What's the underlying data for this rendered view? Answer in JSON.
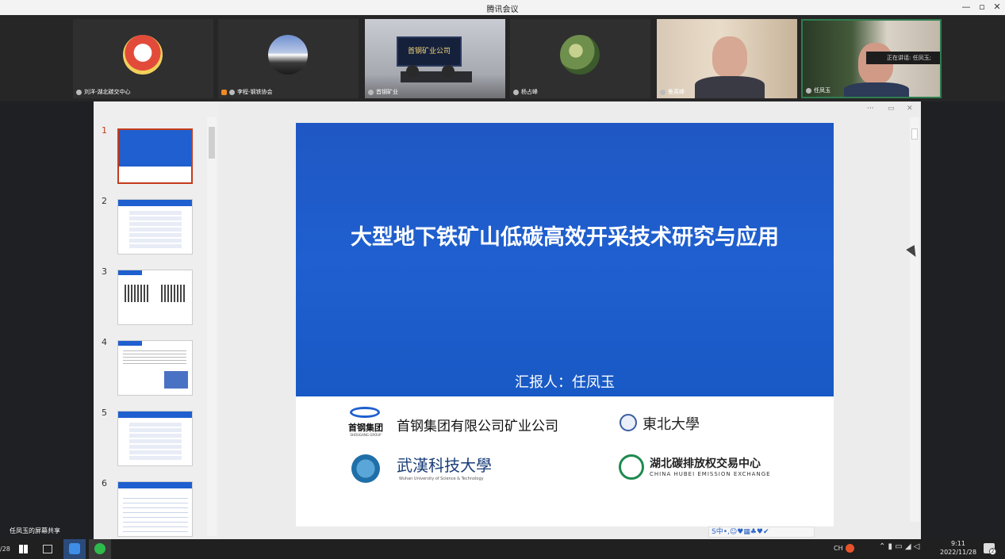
{
  "window": {
    "title": "腾讯会议",
    "minimize": "—",
    "restore": "▫",
    "close": "✕"
  },
  "participants": [
    {
      "name": "刘洋-湖北碳交中心"
    },
    {
      "name": "李程-钢铁协会"
    },
    {
      "name": "首钢矿业",
      "banner": "首钢矿业公司"
    },
    {
      "name": "杨占峰"
    },
    {
      "name": "鲁英峰"
    },
    {
      "name": "任凤玉"
    }
  ],
  "speaking": {
    "text": "正在讲话: 任凤玉;"
  },
  "ppt": {
    "thumbnails": [
      {
        "number": "1"
      },
      {
        "number": "2"
      },
      {
        "number": "3"
      },
      {
        "number": "4"
      },
      {
        "number": "5"
      },
      {
        "number": "6"
      }
    ],
    "window_controls": {
      "more": "···",
      "pin": "▭",
      "close": "✕"
    }
  },
  "slide": {
    "title": "大型地下铁矿山低碳高效开采技术研究与应用",
    "reporter": "汇报人：任凤玉",
    "logos": [
      {
        "text": "首钢集团有限公司矿业公司",
        "brand": "首钢集团",
        "brand_en": "SHOUGANG GROUP"
      },
      {
        "text": "東北大學"
      },
      {
        "text": "武漢科技大學",
        "sub": "Wuhan University of Science & Technology"
      },
      {
        "text": "湖北碳排放权交易中心",
        "sub": "CHINA HUBEI EMISSION EXCHANGE"
      }
    ]
  },
  "screen_share": {
    "label": "任凤玉的屏幕共享"
  },
  "ime_bar": {
    "text": "S中•,☺♥▦♣♥✔"
  },
  "taskbar": {
    "lang": "CH",
    "time": "9:11",
    "date": "2022/11/28",
    "left_partial": "/28",
    "notifications": "2"
  },
  "colors": {
    "slide_blue": "#1f5fcf",
    "active_thumb_border": "#c43b1c",
    "speaking_border": "#2e7d4f"
  }
}
